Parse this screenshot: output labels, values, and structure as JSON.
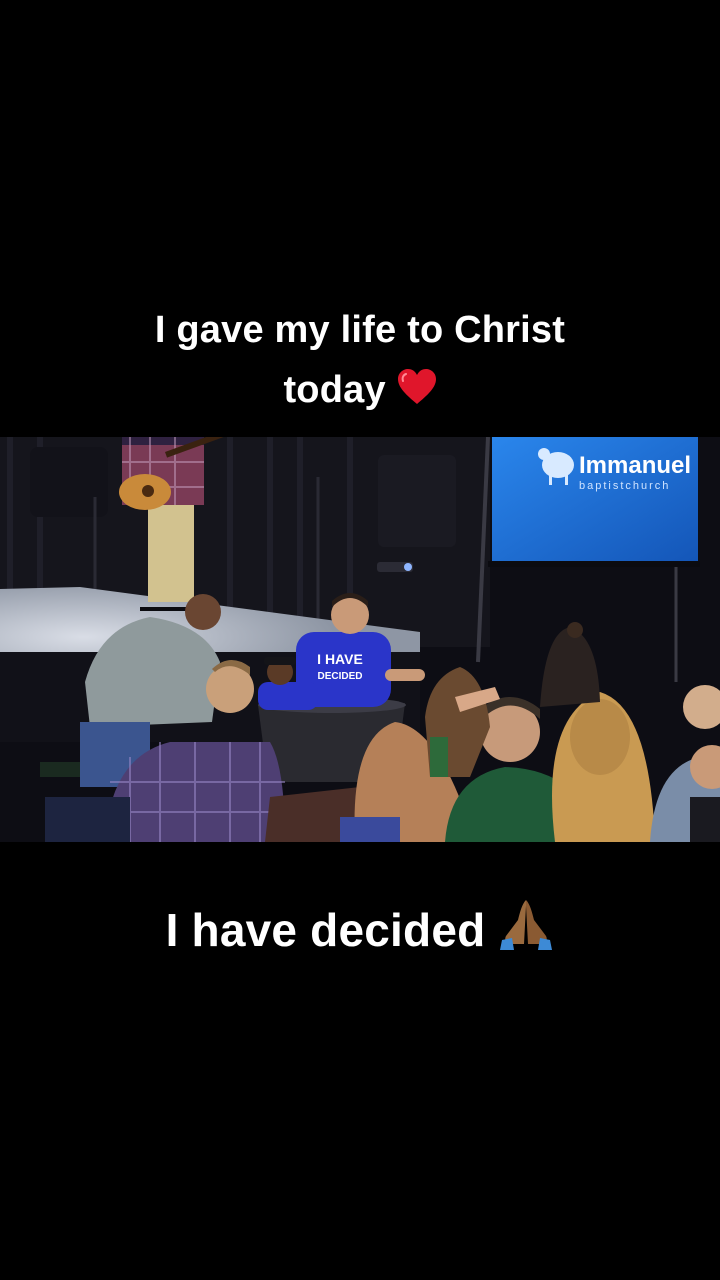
{
  "captions": {
    "top_line1": "I gave my life to Christ",
    "top_line2": "today",
    "bottom": "I have decided"
  },
  "icons": {
    "heart": "red-heart-icon",
    "prayer": "folded-hands-icon"
  },
  "video": {
    "screen_title": "Immanuel",
    "screen_subtitle": "baptistchurch",
    "shirt_line1": "I HAVE",
    "shirt_line2": "DECIDED"
  },
  "colors": {
    "background": "#000000",
    "text": "#ffffff",
    "screen_blue": "#1e72d8",
    "heart_red": "#e0162b",
    "shirt_blue": "#2a35c9"
  }
}
